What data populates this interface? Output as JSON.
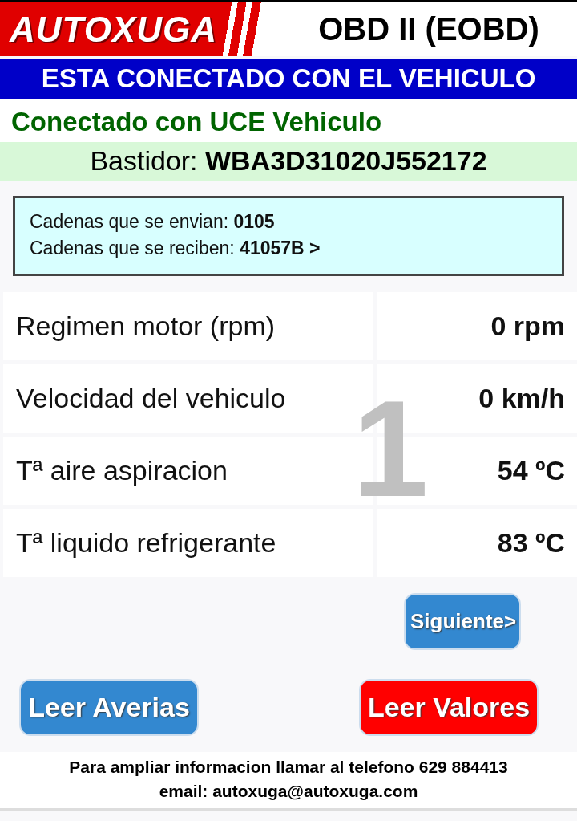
{
  "header": {
    "logo": "AUTOXUGA",
    "title": "OBD II (EOBD)"
  },
  "connection_banner": "ESTA CONECTADO CON EL VEHICULO",
  "status": "Conectado con UCE Vehiculo",
  "vin": "Bastidor: **WBA3D31020J552172**",
  "strings_box": [
    "Cadenas que se envian: **0105**",
    "Cadenas que se reciben: **41057B >**"
  ],
  "page_number": "1",
  "readings": [
    {
      "name": "Regimen motor (rpm)",
      "value": "0 rpm"
    },
    {
      "name": "Velocidad del vehiculo",
      "value": "0 km/h"
    },
    {
      "name": "Tª aire aspiracion",
      "value": "54 ºC"
    },
    {
      "name": "Tª liquido refrigerante",
      "value": "83 ºC"
    }
  ],
  "next_button": "Siguiente>",
  "buttons": [
    {
      "label": "Leer Averias",
      "color": "#3388d0"
    },
    {
      "label": "Leer Valores",
      "color": "#ff0000"
    }
  ],
  "footer": [
    "Para ampliar informacion llamar al telefono 629 884413",
    "email: autoxuga@autoxuga.com"
  ]
}
